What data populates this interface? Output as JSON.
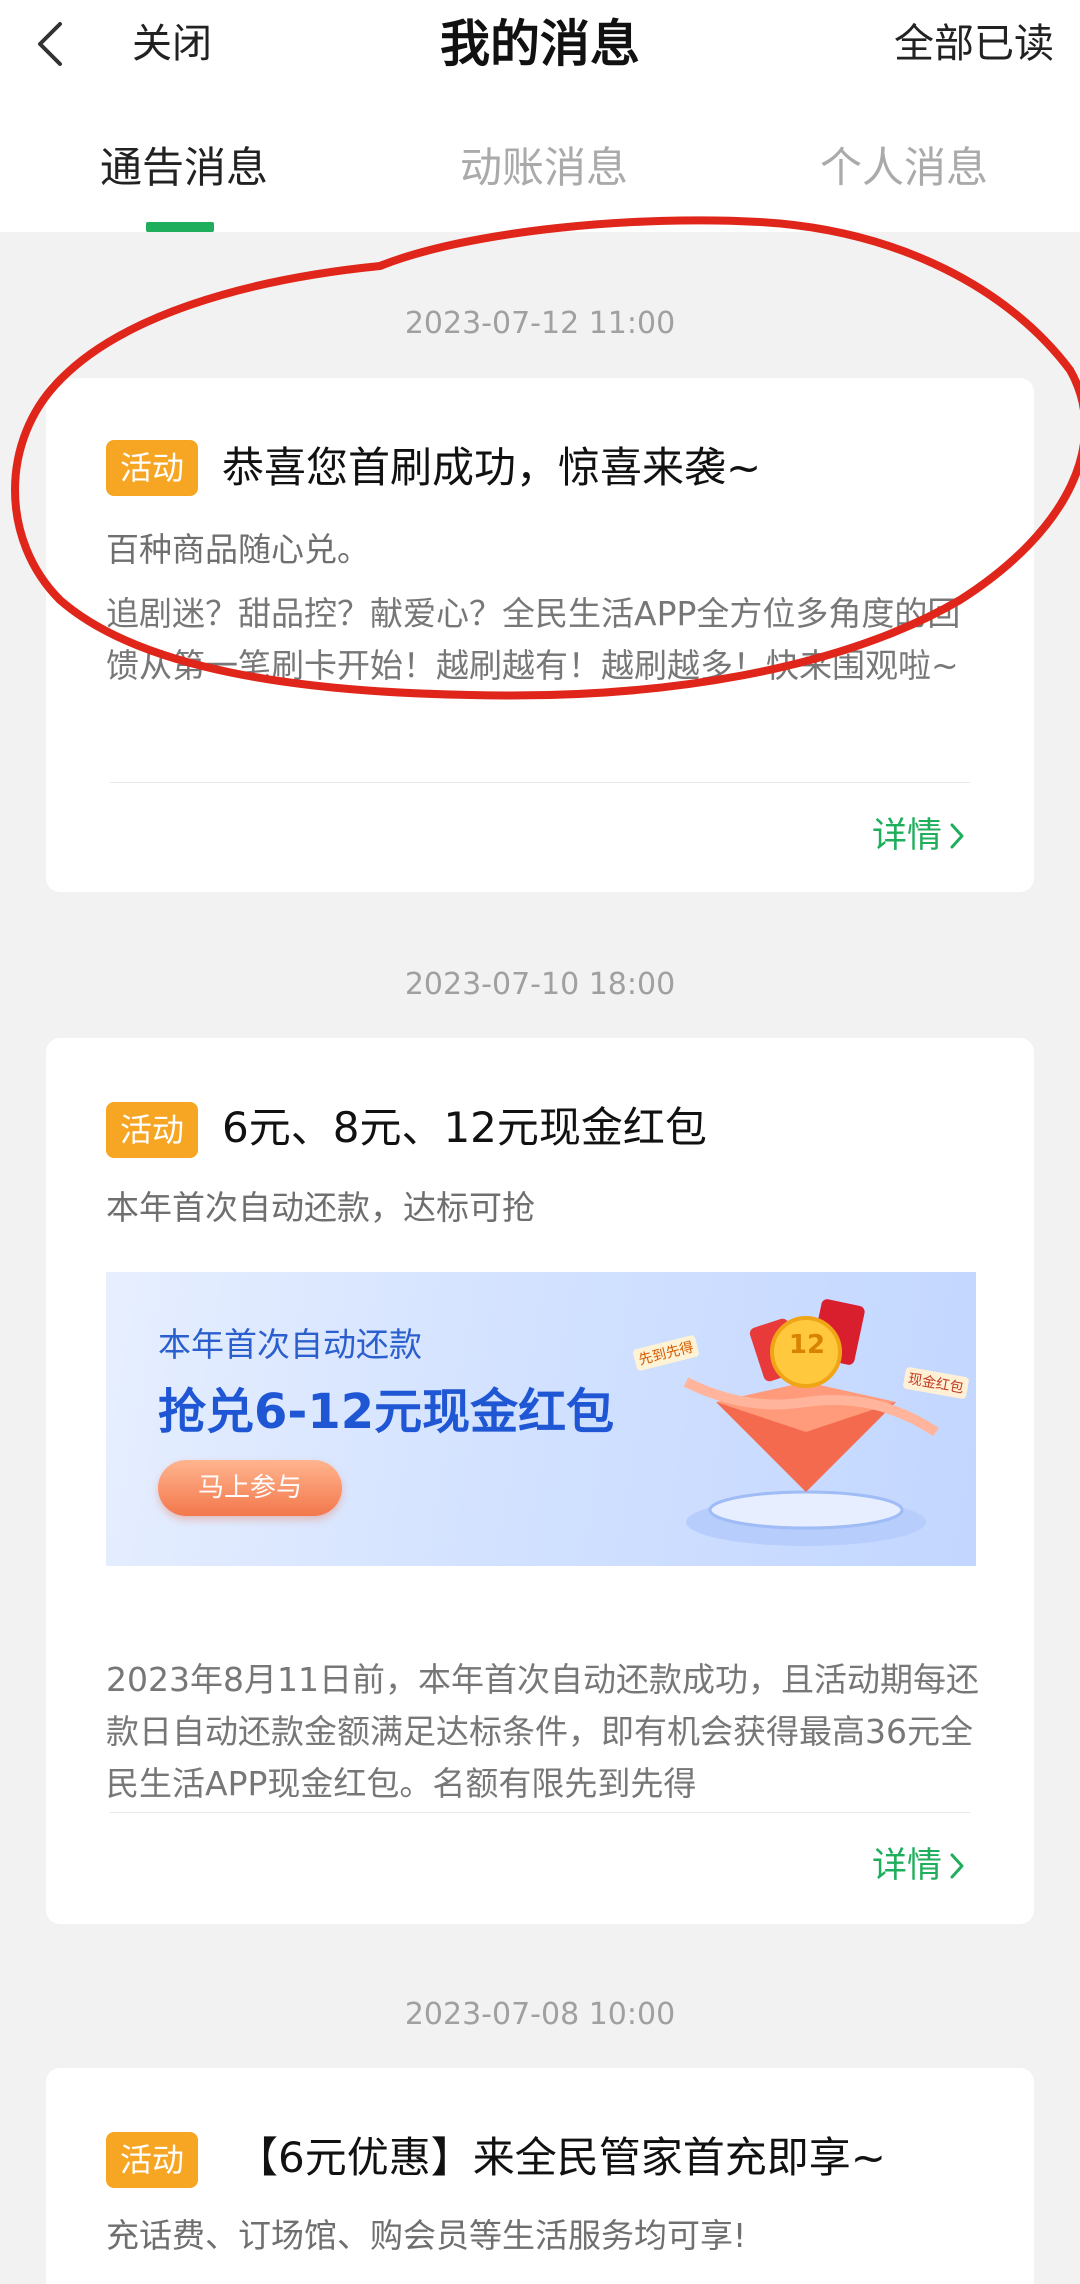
{
  "header": {
    "close_label": "关闭",
    "title": "我的消息",
    "mark_all_read": "全部已读"
  },
  "tabs": [
    {
      "label": "通告消息",
      "active": true
    },
    {
      "label": "动账消息",
      "active": false
    },
    {
      "label": "个人消息",
      "active": false
    }
  ],
  "accent_color": "#1fae5b",
  "badge_color": "#f6a623",
  "messages": [
    {
      "date": "2023-07-12 11:00",
      "badge": "活动",
      "title": "恭喜您首刷成功，惊喜来袭~",
      "subtitle": "百种商品随心兑。",
      "body": "追剧迷？甜品控？献爱心？全民生活APP全方位多角度的回馈从第一笔刷卡开始！越刷越有！越刷越多！快来围观啦~",
      "detail": "详情"
    },
    {
      "date": "2023-07-10 18:00",
      "badge": "活动",
      "title": "6元、8元、12元现金红包",
      "subtitle": "本年首次自动还款，达标可抢",
      "banner": {
        "line1": "本年首次自动还款",
        "line2": "抢兑6-12元现金红包",
        "button": "马上参与",
        "coin_text": "12",
        "tag_left": "先到先得",
        "tag_right": "现金红包"
      },
      "body": "2023年8月11日前，本年首次自动还款成功，且活动期每还款日自动还款金额满足达标条件，即有机会获得最高36元全民生活APP现金红包。名额有限先到先得",
      "detail": "详情"
    },
    {
      "date": "2023-07-08 10:00",
      "badge": "活动",
      "title": "【6元优惠】来全民管家首充即享~",
      "subtitle": "充话费、订场馆、购会员等生活服务均可享!"
    }
  ]
}
